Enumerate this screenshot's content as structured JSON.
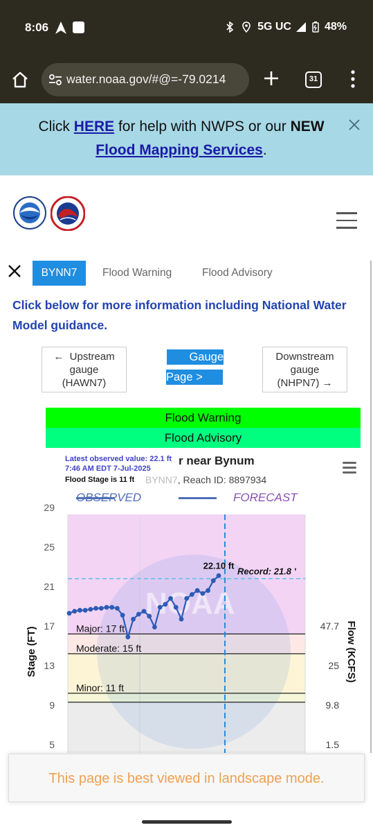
{
  "status": {
    "time": "8:06",
    "network": "5G UC",
    "battery": "48%"
  },
  "browser": {
    "url": "water.noaa.gov/#@=-79.0214",
    "tab_count": "31"
  },
  "banner": {
    "click": "Click ",
    "here_link": "HERE",
    "middle": " for help with NWPS or our ",
    "new": "NEW",
    "mapping_link": "Flood Mapping Services",
    "period": "."
  },
  "panel": {
    "tabs": [
      "BYNN7",
      "Flood Warning",
      "Flood Advisory"
    ],
    "info": "Click below for more information including National Water Model guidance.",
    "upstream": {
      "arrow": "←",
      "label": "Upstream",
      "line2": "gauge",
      "line3": "(HAWN7)"
    },
    "gauge_page": {
      "line1": "Gauge",
      "line2": "Page >"
    },
    "downstream": {
      "line1": "Downstream",
      "line2": "gauge",
      "line3": "(NHPN7)",
      "arrow": "→"
    },
    "alerts": [
      "Flood Warning",
      "Flood Advisory"
    ]
  },
  "chart_header": {
    "latest_line1": "Latest observed value: 22.1 ft",
    "latest_line2": "7:46 AM EDT 7-Jul-2025",
    "flood_stage": "Flood Stage is 11 ft",
    "title": "r near Bynum",
    "subtitle_faded": "BYNN7",
    "subtitle": ", Reach ID: 8897934",
    "legend_observed": "OBSERVED",
    "legend_forecast": "FORECAST"
  },
  "chart_data": {
    "type": "line",
    "ylabel": "Stage (FT)",
    "y2label": "Flow (KCFS)",
    "y_ticks": [
      5,
      9,
      13,
      17,
      21,
      25,
      29
    ],
    "y2_ticks": [
      {
        "stage": 17,
        "label": "47.7"
      },
      {
        "stage": 13,
        "label": "25"
      },
      {
        "stage": 9,
        "label": "9.8"
      },
      {
        "stage": 5,
        "label": "1.5"
      }
    ],
    "ylim": [
      4,
      30
    ],
    "thresholds": [
      {
        "name": "Major",
        "label": "Major: 17 ft",
        "value": 16.2
      },
      {
        "name": "Moderate",
        "label": "Moderate: 15 ft",
        "value": 14.2
      },
      {
        "name": "Minor",
        "label": "Minor: 11 ft",
        "value": 10.2
      },
      {
        "name": "Action",
        "label": "",
        "value": 9.3
      }
    ],
    "record": {
      "label": "Record: 21.8 '",
      "value": 21.8
    },
    "peak_label": "22.10 ft",
    "colors": {
      "major": "#f3d4f5",
      "moderate": "#fde8e6",
      "minor": "#fdf4d6",
      "action": "#f5f7d8",
      "normal": "#ececec",
      "series": "#2c5bb5",
      "record": "#5bc0e8",
      "now_line": "#2a8ad8"
    },
    "series": [
      {
        "values": [
          18.3,
          18.5,
          18.6,
          18.6,
          18.7,
          18.8,
          18.8,
          18.9,
          18.9,
          18.8,
          18.1,
          15.9,
          17.7,
          18.2,
          18.5,
          18.0,
          16.9,
          18.9,
          19.2,
          19.8,
          18.9,
          17.7,
          19.8,
          20.2,
          20.6,
          20.3,
          20.6,
          21.6,
          22.1
        ]
      }
    ],
    "watermark": "NOAA"
  },
  "footer": {
    "landscape_note": "This page is best viewed in landscape mode."
  }
}
